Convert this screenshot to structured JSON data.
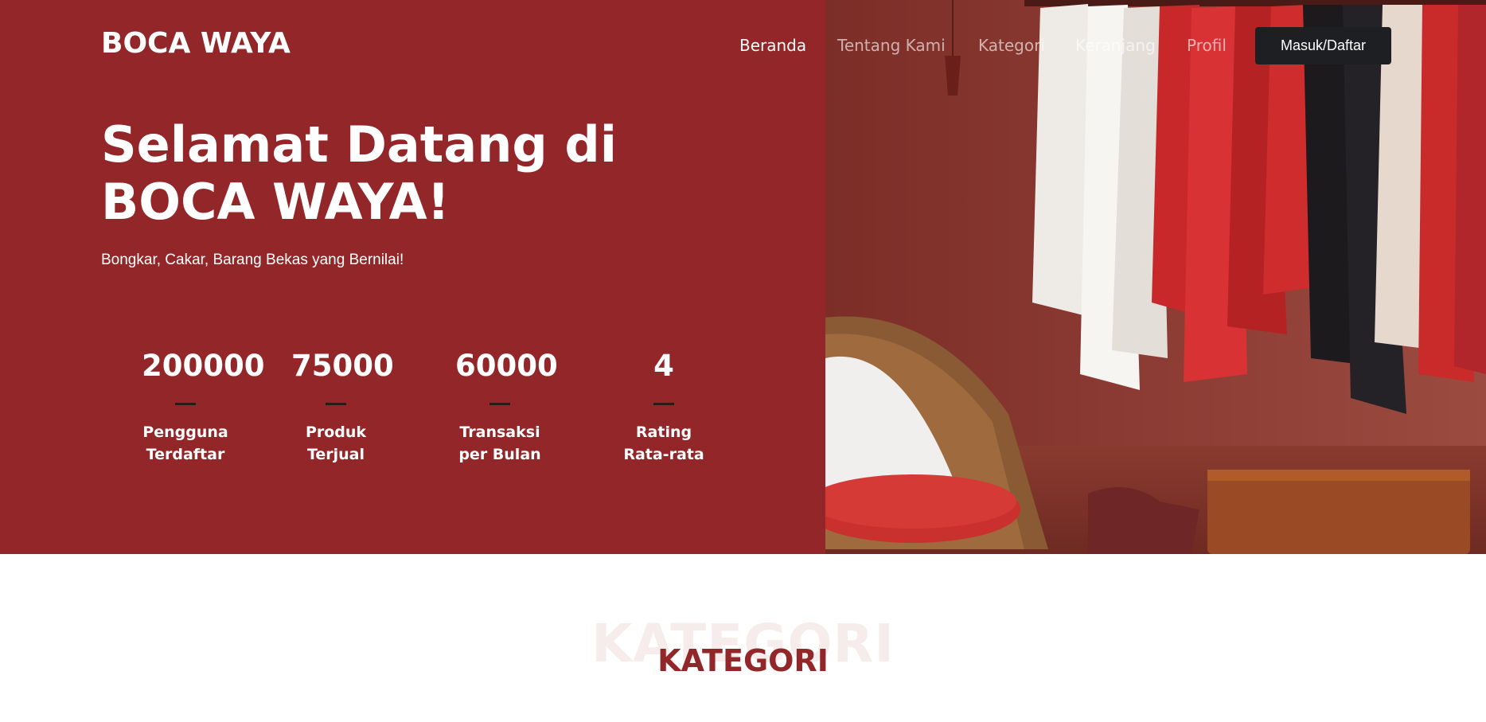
{
  "brand": {
    "name": "BOCA WAYA"
  },
  "nav": {
    "items": [
      {
        "label": "Beranda"
      },
      {
        "label": "Tentang Kami"
      },
      {
        "label": "Kategori"
      },
      {
        "label": "Keranjang"
      },
      {
        "label": "Profil"
      }
    ],
    "login_label": "Masuk/Daftar"
  },
  "hero": {
    "title": "Selamat Datang di BOCA WAYA!",
    "subtitle": "Bongkar, Cakar, Barang Bekas yang Bernilai!",
    "stats": [
      {
        "value": "200000",
        "label_line1": "Pengguna",
        "label_line2": "Terdaftar"
      },
      {
        "value": "75000",
        "label_line1": "Produk",
        "label_line2": "Terjual"
      },
      {
        "value": "60000",
        "label_line1": "Transaksi",
        "label_line2": "per Bulan"
      },
      {
        "value": "4",
        "label_line1": "Rating",
        "label_line2": "Rata-rata"
      }
    ]
  },
  "section": {
    "title_watermark": "KATEGORI",
    "title": "KATEGORI"
  },
  "colors": {
    "hero_bg": "#932628",
    "button_bg": "#1d1f23",
    "accent": "#932628"
  }
}
